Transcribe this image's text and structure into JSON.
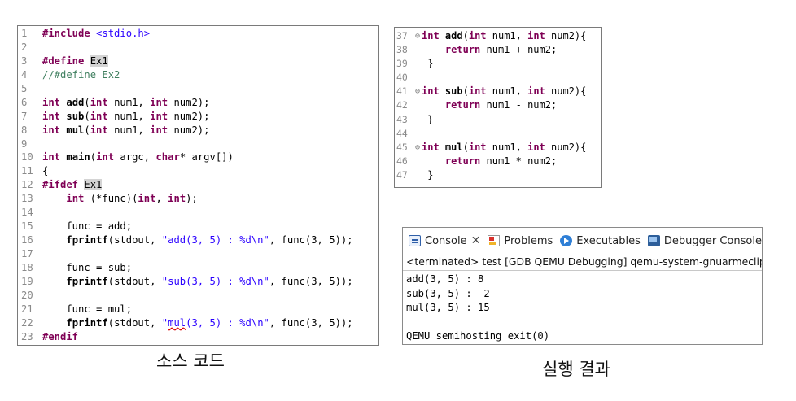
{
  "source_editor": {
    "lines": [
      {
        "no": "1"
      },
      {
        "no": "2"
      },
      {
        "no": "3"
      },
      {
        "no": "4"
      },
      {
        "no": "5"
      },
      {
        "no": "6"
      },
      {
        "no": "7"
      },
      {
        "no": "8"
      },
      {
        "no": "9"
      },
      {
        "no": "10"
      },
      {
        "no": "11"
      },
      {
        "no": "12"
      },
      {
        "no": "13"
      },
      {
        "no": "14"
      },
      {
        "no": "15"
      },
      {
        "no": "16"
      },
      {
        "no": "17"
      },
      {
        "no": "18"
      },
      {
        "no": "19"
      },
      {
        "no": "20"
      },
      {
        "no": "21"
      },
      {
        "no": "22"
      },
      {
        "no": "23"
      }
    ],
    "t": {
      "include": "#include",
      "stdio": " <stdio.h>",
      "define": "#define",
      "ex1": "Ex1",
      "comment_define": "//#define Ex2",
      "int": "int",
      "char": "char",
      "space": " ",
      "add": "add",
      "sub": "sub",
      "mul": "mul",
      "main": "main",
      "proto_open": "(",
      "num1": " num1, ",
      "num2_close": " num2);",
      "main_args_a": "(",
      "main_args_b": " argc, ",
      "main_args_c": "* argv[])",
      "brace_open": "{",
      "ifdef": "#ifdef",
      "indent": "    ",
      "func_ptr_a": " (*func)(",
      "func_ptr_b": ", ",
      "func_ptr_c": ");",
      "assign_add": "    func = add;",
      "assign_sub": "    func = sub;",
      "assign_mul": "    func = mul;",
      "fprintf": "fprintf",
      "stdout_part": "(stdout, ",
      "fmt_add": "\"add(3, 5) : %d\\n\"",
      "fmt_sub": "\"sub(3, 5) : %d\\n\"",
      "fmt_mul_q": "\"",
      "fmt_mul_mul": "mul",
      "fmt_mul_rest": "(3, 5) : %d\\n\"",
      "call_tail": ", func(3, 5));",
      "endif": "#endif"
    }
  },
  "functions_editor": {
    "lines": [
      {
        "no": "37"
      },
      {
        "no": "38"
      },
      {
        "no": "39"
      },
      {
        "no": "40"
      },
      {
        "no": "41"
      },
      {
        "no": "42"
      },
      {
        "no": "43"
      },
      {
        "no": "44"
      },
      {
        "no": "45"
      },
      {
        "no": "46"
      },
      {
        "no": "47"
      }
    ],
    "fold_marker": "⊖",
    "t": {
      "int": "int",
      "add": "add",
      "sub": "sub",
      "mul": "mul",
      "sig_a": "(",
      "sig_b": " num1, ",
      "sig_c": " num2){",
      "ret_indent": "    ",
      "return": "return",
      "ret_add": " num1 + num2;",
      "ret_sub": " num1 - num2;",
      "ret_mul": " num1 * num2;",
      "close": " }"
    }
  },
  "console": {
    "tabs": {
      "console": "Console",
      "close": "✕",
      "problems": "Problems",
      "executables": "Executables",
      "debugger_console": "Debugger Console"
    },
    "status": "<terminated> test [GDB QEMU Debugging] qemu-system-gnuarmeclipse",
    "output": [
      "add(3, 5) : 8",
      "sub(3, 5) : -2",
      "mul(3, 5) : 15",
      "",
      "QEMU semihosting exit(0)"
    ]
  },
  "captions": {
    "source": "소스 코드",
    "result": "실행 결과"
  }
}
